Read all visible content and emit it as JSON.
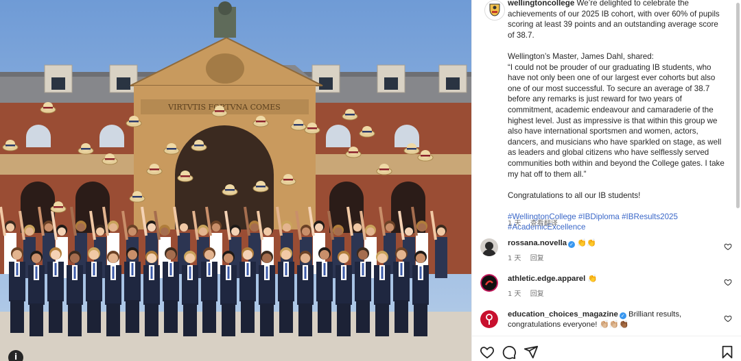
{
  "post": {
    "username": "wellingtoncollege",
    "caption_intro": " We’re delighted to celebrate the achievements of our 2025 IB cohort, with over 60% of pupils scoring at least 39 points and an outstanding average score of 38.7.",
    "caption_p2": "Wellington’s Master, James Dahl, shared:",
    "caption_quote": "“I could not be prouder of our graduating IB students, who have not only been one of our largest ever cohorts but also one of our most successful. To secure an average of 38.7 before any remarks is just reward for two years of commitment, academic endeavour and camaraderie of the highest level. Just as impressive is that within this group we also have international sportsmen and women, actors, dancers, and musicians who have sparkled on stage, as well as leaders and global citizens who have selflessly served communities both within and beyond the College gates. I take my hat off to them all.”",
    "caption_p4": "Congratulations to all our IB students!",
    "hashtags": [
      "#WellingtonCollege",
      "#IBDiploma",
      "#IBResults2025",
      "#AcademicExcellence"
    ],
    "time": "1 天",
    "see_translation": "查看翻译"
  },
  "photo": {
    "inscription": "VIRTVTIS FORTVNA COMES"
  },
  "comments": [
    {
      "username": "rossana.novella",
      "verified": true,
      "text": "👏👏",
      "time": "1 天",
      "reply": "回复",
      "avatar_color": "#3a3a3a"
    },
    {
      "username": "athletic.edge.apparel",
      "verified": false,
      "text": "👏",
      "time": "1 天",
      "reply": "回复",
      "avatar_color": "#111111"
    },
    {
      "username": "education_choices_magazine",
      "verified": true,
      "text": "Brilliant results, congratulations everyone! 👏🏼👏🏼👏🏾",
      "time": "",
      "reply": "",
      "avatar_color": "#c8102e"
    }
  ],
  "colors": {
    "link": "#3a67c8",
    "verified": "#3897f0",
    "muted": "#737373",
    "text": "#262626"
  },
  "icons": [
    "info-icon",
    "heart-icon",
    "comment-icon",
    "share-icon",
    "bookmark-icon"
  ]
}
